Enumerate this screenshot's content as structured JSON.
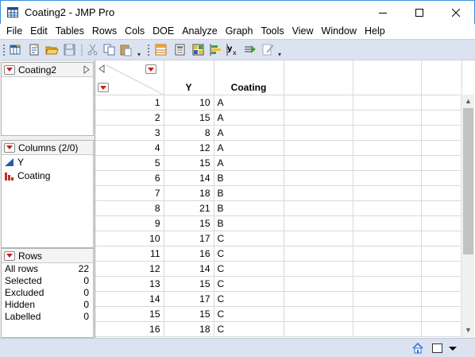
{
  "window": {
    "title": "Coating2 - JMP Pro"
  },
  "menu": [
    "File",
    "Edit",
    "Tables",
    "Rows",
    "Cols",
    "DOE",
    "Analyze",
    "Graph",
    "Tools",
    "View",
    "Window",
    "Help"
  ],
  "toolbar_icons": [
    "new-data-table-icon",
    "new-script-icon",
    "open-icon",
    "save-icon",
    "cut-icon",
    "copy-icon",
    "paste-icon",
    "data-table-icon",
    "journal-icon",
    "layout-icon",
    "bar-chart-icon",
    "formula-icon",
    "run-script-icon",
    "edit-icon"
  ],
  "table_panel": {
    "name": "Coating2"
  },
  "columns_panel": {
    "header": "Columns (2/0)",
    "columns": [
      {
        "name": "Y",
        "icon": "continuous-icon"
      },
      {
        "name": "Coating",
        "icon": "nominal-icon"
      }
    ]
  },
  "rows_panel": {
    "header": "Rows",
    "stats": [
      {
        "label": "All rows",
        "value": "22"
      },
      {
        "label": "Selected",
        "value": "0"
      },
      {
        "label": "Excluded",
        "value": "0"
      },
      {
        "label": "Hidden",
        "value": "0"
      },
      {
        "label": "Labelled",
        "value": "0"
      }
    ]
  },
  "grid": {
    "columns": [
      "Y",
      "Coating"
    ],
    "rows": [
      {
        "n": "1",
        "y": "10",
        "c": "A"
      },
      {
        "n": "2",
        "y": "15",
        "c": "A"
      },
      {
        "n": "3",
        "y": "8",
        "c": "A"
      },
      {
        "n": "4",
        "y": "12",
        "c": "A"
      },
      {
        "n": "5",
        "y": "15",
        "c": "A"
      },
      {
        "n": "6",
        "y": "14",
        "c": "B"
      },
      {
        "n": "7",
        "y": "18",
        "c": "B"
      },
      {
        "n": "8",
        "y": "21",
        "c": "B"
      },
      {
        "n": "9",
        "y": "15",
        "c": "B"
      },
      {
        "n": "10",
        "y": "17",
        "c": "C"
      },
      {
        "n": "11",
        "y": "16",
        "c": "C"
      },
      {
        "n": "12",
        "y": "14",
        "c": "C"
      },
      {
        "n": "13",
        "y": "15",
        "c": "C"
      },
      {
        "n": "14",
        "y": "17",
        "c": "C"
      },
      {
        "n": "15",
        "y": "15",
        "c": "C"
      },
      {
        "n": "16",
        "y": "18",
        "c": "C"
      }
    ]
  },
  "colors": {
    "toolbar_bg": "#dce3f0",
    "red_triangle": "#d11a1a",
    "window_border": "#3b8fd8"
  }
}
